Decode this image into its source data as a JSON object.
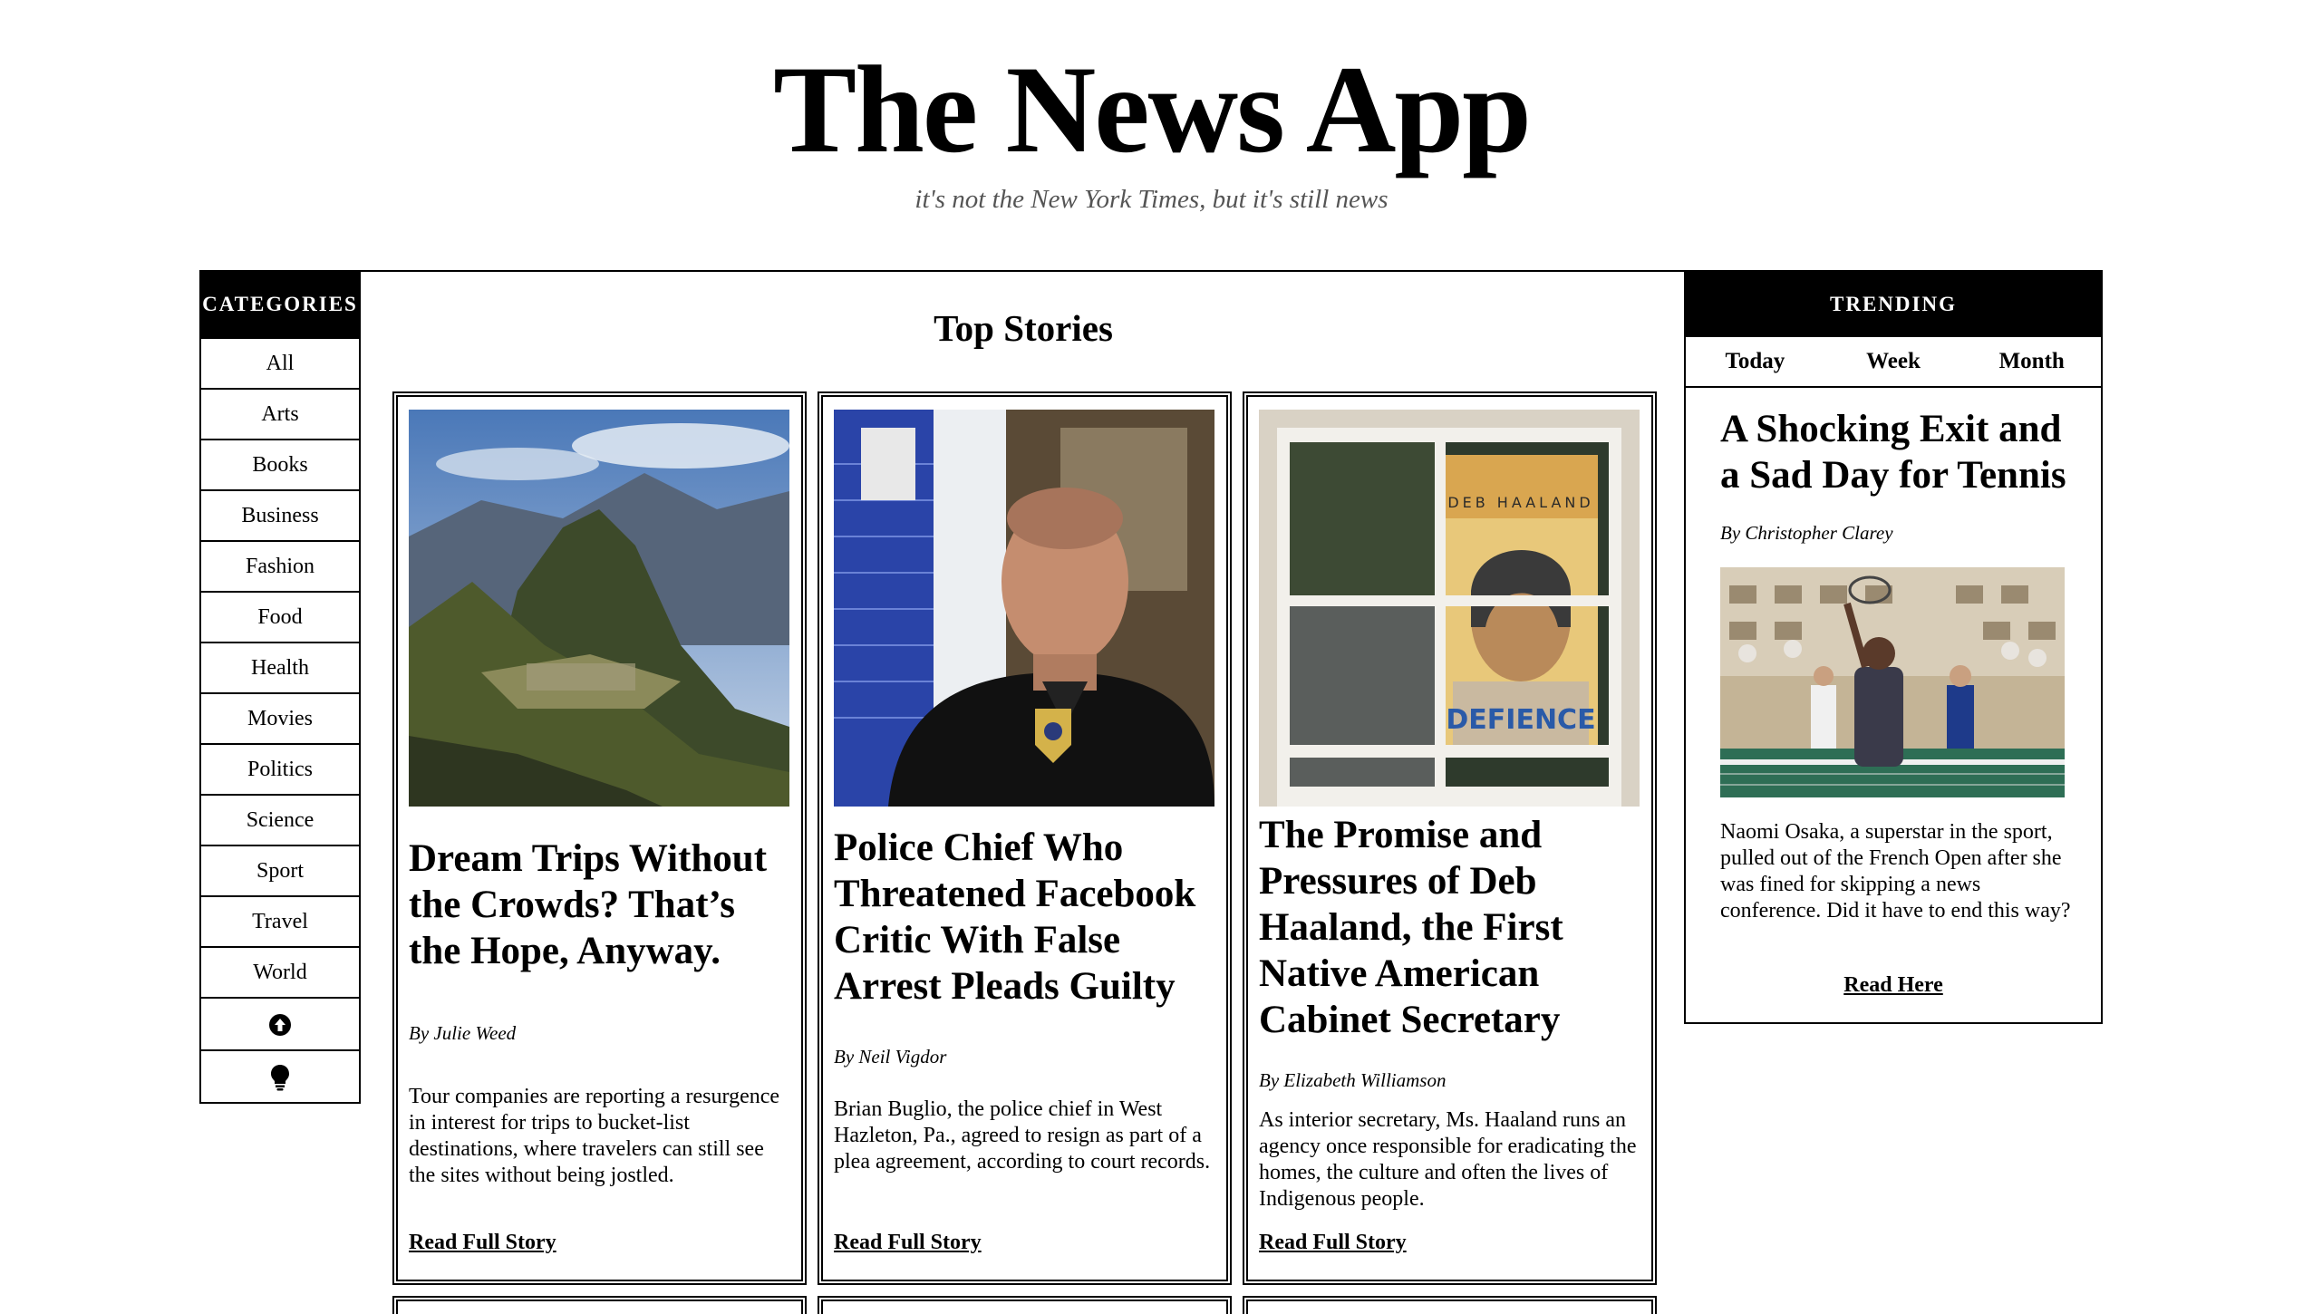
{
  "header": {
    "title": "The News App",
    "tagline": "it's not the New York Times, but it's still news"
  },
  "categories": {
    "heading": "CATEGORIES",
    "items": [
      "All",
      "Arts",
      "Books",
      "Business",
      "Fashion",
      "Food",
      "Health",
      "Movies",
      "Politics",
      "Science",
      "Sport",
      "Travel",
      "World"
    ],
    "icons": [
      "arrow-up-circle-icon",
      "lightbulb-icon"
    ]
  },
  "main": {
    "heading": "Top Stories",
    "stories": [
      {
        "headline": "Dream Trips Without the Crowds? That’s the Hope, Anyway.",
        "byline": "By Julie Weed",
        "summary": "Tour companies are reporting a resurgence in interest for trips to bucket-list destinations, where travelers can still see the sites without being jostled.",
        "link": "Read Full Story",
        "image": "mountain-ruins-photo"
      },
      {
        "headline": "Police Chief Who Threatened Facebook Critic With False Arrest Pleads Guilty",
        "byline": "By Neil Vigdor",
        "summary": "Brian Buglio, the police chief in West Hazleton, Pa., agreed to resign as part of a plea agreement, according to court records.",
        "link": "Read Full Story",
        "image": "police-chief-photo"
      },
      {
        "headline": "The Promise and Pressures of Deb Haaland, the First Native American Cabinet Secretary",
        "byline": "By Elizabeth Williamson",
        "summary": "As interior secretary, Ms. Haaland runs an agency once responsible for eradicating the homes, the culture and often the lives of Indigenous people.",
        "link": "Read Full Story",
        "image": "window-poster-photo",
        "poster_top": "DEB HAALAND",
        "poster_bottom": "DEFIENCE"
      }
    ]
  },
  "trending": {
    "heading": "TRENDING",
    "tabs": [
      "Today",
      "Week",
      "Month"
    ],
    "story": {
      "headline": "A Shocking Exit and a Sad Day for Tennis",
      "byline": "By Christopher Clarey",
      "summary": "Naomi Osaka, a superstar in the sport, pulled out of the French Open after she was fined for skipping a news conference. Did it have to end this way?",
      "link": "Read Here",
      "image": "tennis-player-photo"
    }
  }
}
